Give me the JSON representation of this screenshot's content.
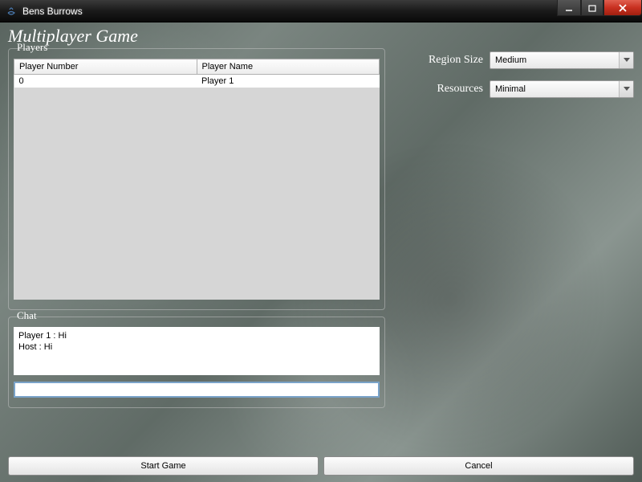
{
  "window": {
    "title": "Bens Burrows"
  },
  "page": {
    "title": "Multiplayer Game"
  },
  "players": {
    "group_label": "Players",
    "columns": {
      "number": "Player Number",
      "name": "Player Name"
    },
    "rows": [
      {
        "number": "0",
        "name": "Player 1"
      }
    ]
  },
  "chat": {
    "group_label": "Chat",
    "messages": [
      "Player 1 : Hi",
      "Host : Hi"
    ],
    "input_value": ""
  },
  "settings": {
    "region_size": {
      "label": "Region Size",
      "value": "Medium"
    },
    "resources": {
      "label": "Resources",
      "value": "Minimal"
    }
  },
  "buttons": {
    "start": "Start Game",
    "cancel": "Cancel"
  }
}
